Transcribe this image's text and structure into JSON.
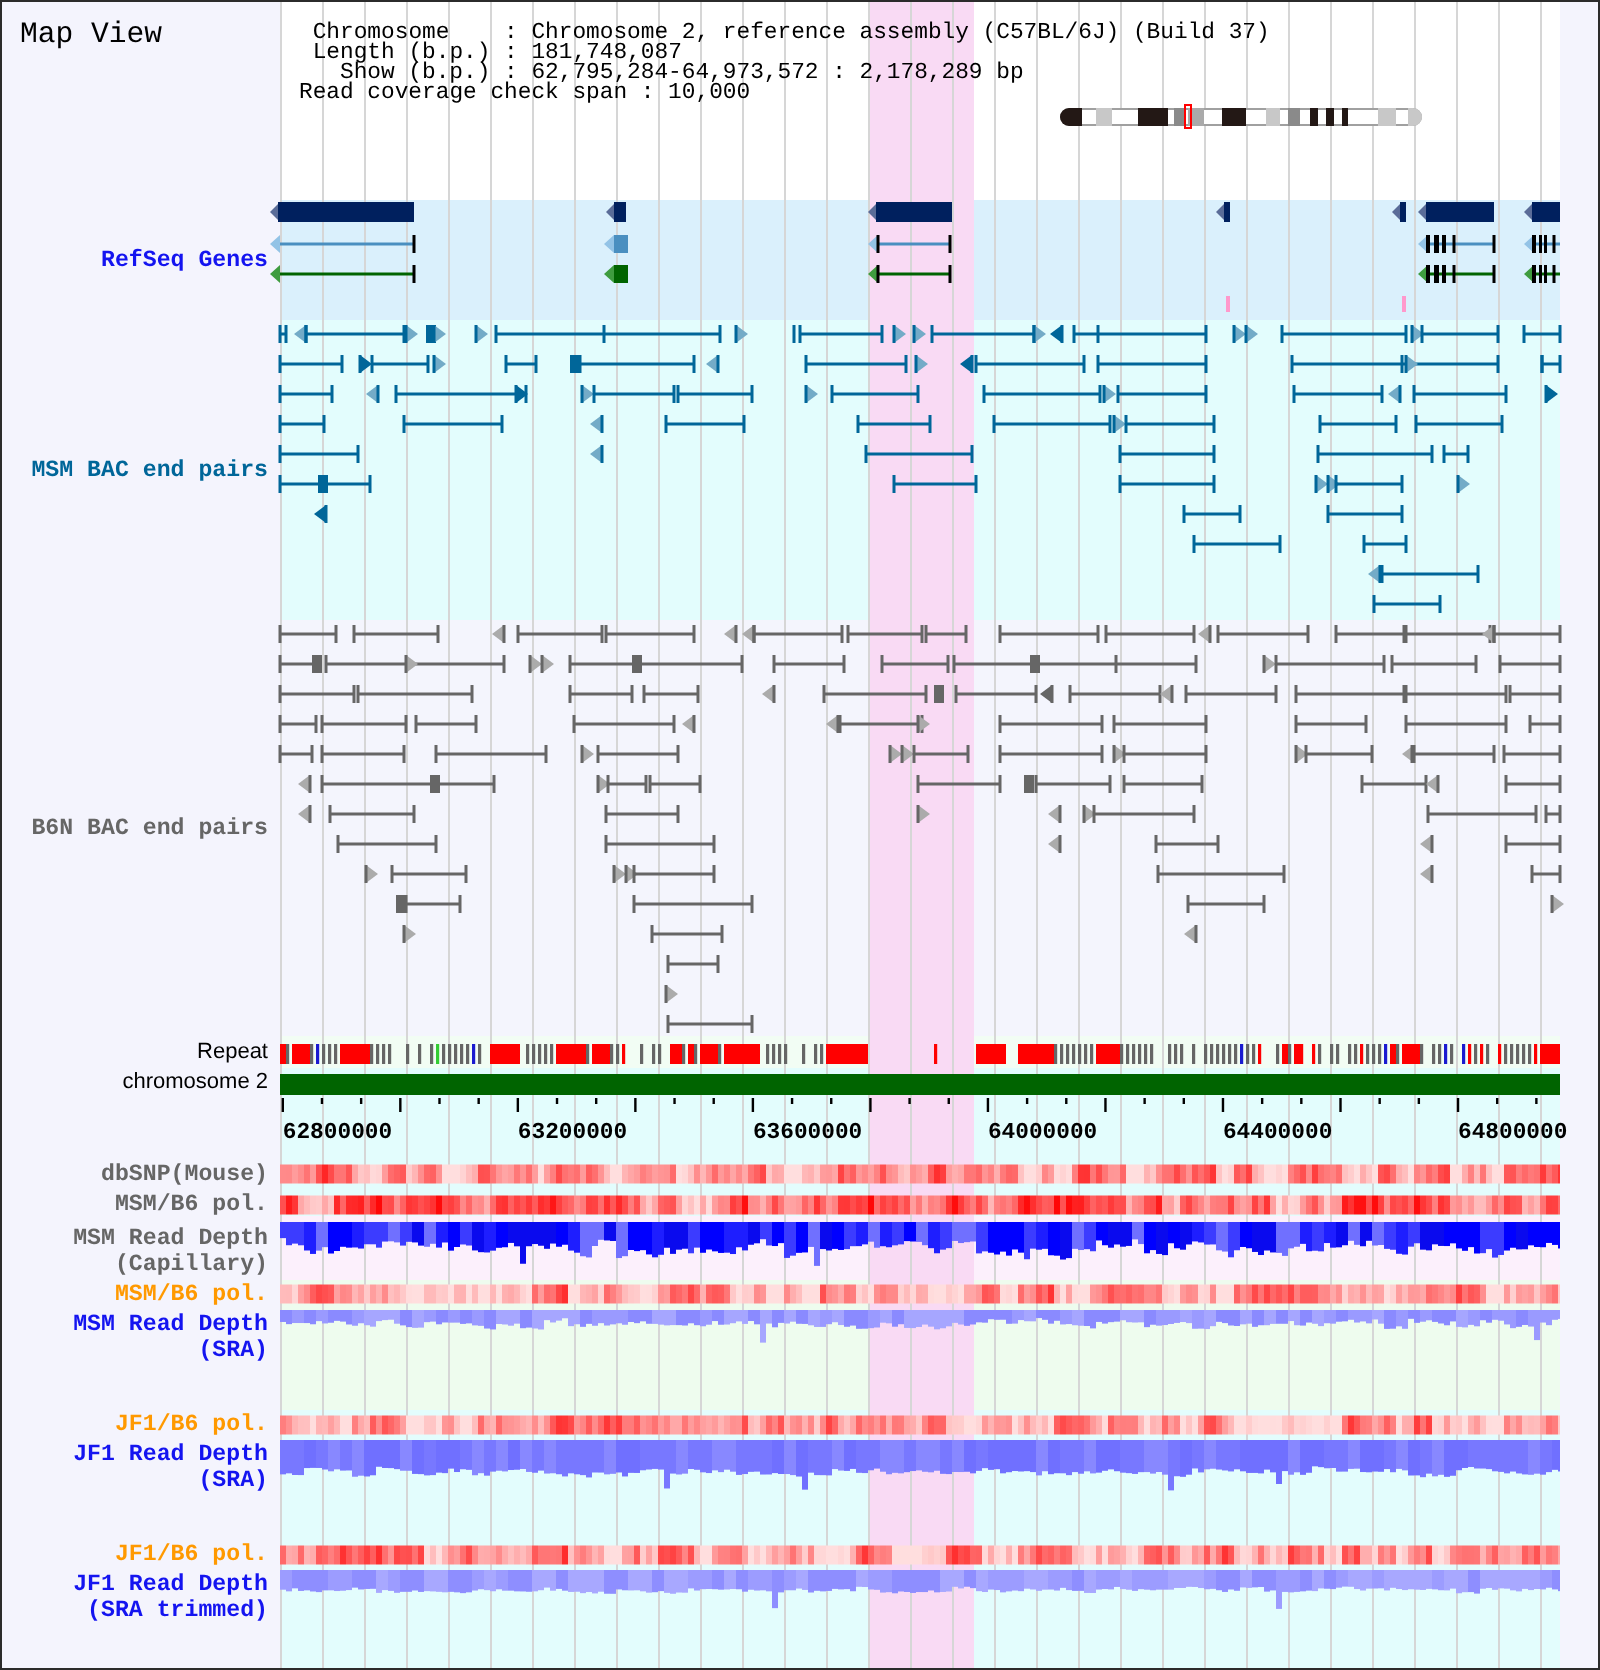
{
  "title": "Map View",
  "info_lines": [
    "Chromosome    : Chromosome 2, reference assembly (C57BL/6J) (Build 37)",
    "Length (b.p.) : 181,748,087",
    "Show (b.p.) : 62,795,284-64,973,572 : 2,178,289 bp",
    "Read coverage check span : 10,000"
  ],
  "tracks": [
    {
      "kind": "genes",
      "label": "RefSeq Genes",
      "color": "#1414f0"
    },
    {
      "kind": "pairs",
      "label": "MSM BAC end pairs",
      "color": "#006699"
    },
    {
      "kind": "pairs",
      "label": "B6N BAC end pairs",
      "color": "#666666"
    },
    {
      "kind": "repeat",
      "label": "Repeat",
      "color": "#000000"
    },
    {
      "kind": "chromosome",
      "label": "chromosome 2",
      "color": "#000000"
    }
  ],
  "ruler": {
    "labels": [
      "62800000",
      "63200000",
      "63600000",
      "64000000",
      "64400000",
      "64800000"
    ]
  },
  "data_tracks": [
    {
      "kind": "heatmap",
      "label_lines": [
        "dbSNP(Mouse)"
      ],
      "color": "#666666"
    },
    {
      "kind": "heatmap",
      "label_lines": [
        "MSM/B6 pol."
      ],
      "color": "#666666"
    },
    {
      "kind": "depth",
      "label_lines": [
        "MSM Read Depth",
        "(Capillary)"
      ],
      "color": "#666666"
    },
    {
      "kind": "heatmap",
      "label_lines": [
        "MSM/B6 pol."
      ],
      "color": "#ff9900"
    },
    {
      "kind": "depth",
      "label_lines": [
        "MSM Read Depth",
        "(SRA)"
      ],
      "color": "#1414f0"
    },
    {
      "kind": "heatmap",
      "label_lines": [
        "JF1/B6 pol."
      ],
      "color": "#ff9900"
    },
    {
      "kind": "depth",
      "label_lines": [
        "JF1 Read Depth",
        "(SRA)"
      ],
      "color": "#1414f0"
    },
    {
      "kind": "heatmap",
      "label_lines": [
        "JF1/B6 pol."
      ],
      "color": "#ff9900"
    },
    {
      "kind": "depth",
      "label_lines": [
        "JF1 Read Depth",
        "(SRA trimmed)"
      ],
      "color": "#1414f0"
    }
  ]
}
